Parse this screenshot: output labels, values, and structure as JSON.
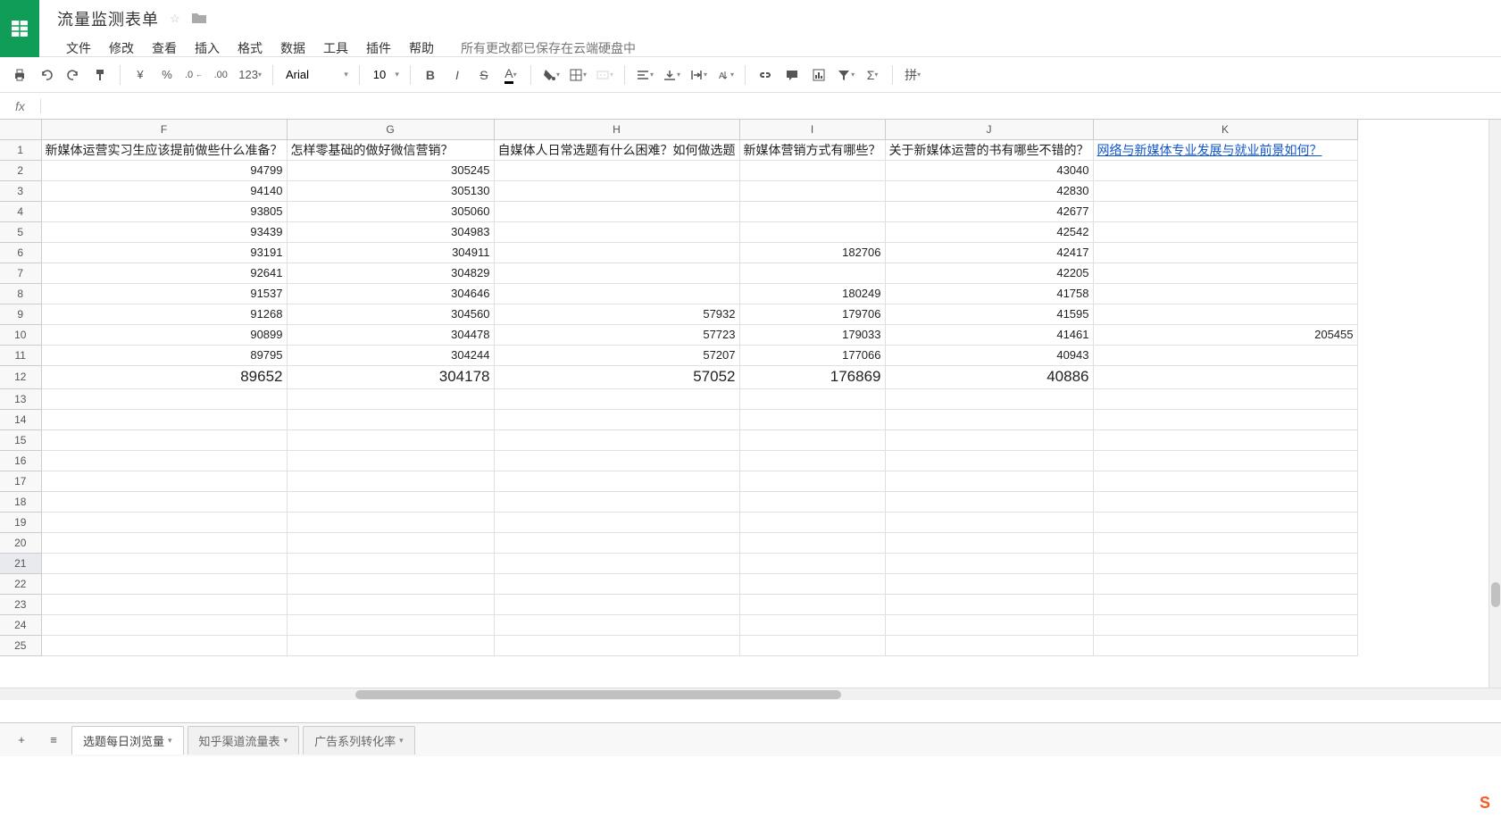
{
  "doc_title": "流量监测表单",
  "menu": [
    "文件",
    "修改",
    "查看",
    "插入",
    "格式",
    "数据",
    "工具",
    "插件",
    "帮助"
  ],
  "save_status": "所有更改都已保存在云端硬盘中",
  "toolbar": {
    "currency": "¥",
    "percent": "%",
    "dec_dec": ".0",
    "dec_inc": ".00",
    "more_formats": "123",
    "font_name": "Arial",
    "font_size": "10",
    "bold": "B",
    "italic": "I",
    "strike": "S",
    "text_color": "A",
    "pinyin": "拼"
  },
  "formula": {
    "fx": "fx",
    "value": ""
  },
  "columns": [
    "F",
    "G",
    "H",
    "I",
    "J",
    "K"
  ],
  "rows": [
    "1",
    "2",
    "3",
    "4",
    "5",
    "6",
    "7",
    "8",
    "9",
    "10",
    "11",
    "12",
    "13",
    "14",
    "15",
    "16",
    "17",
    "18",
    "19",
    "20",
    "21",
    "22",
    "23",
    "24",
    "25"
  ],
  "selected_row": "21",
  "headers_row1": {
    "F": "新媒体运营实习生应该提前做些什么准备？",
    "G": "怎样零基础的做好微信营销？",
    "H": "自媒体人日常选题有什么困难？如何做选题",
    "I": "新媒体营销方式有哪些？",
    "J": "关于新媒体运营的书有哪些不错的？",
    "K": "网络与新媒体专业发展与就业前景如何？"
  },
  "data": {
    "2": {
      "F": "94799",
      "G": "305245",
      "H": "",
      "I": "",
      "J": "43040",
      "K": ""
    },
    "3": {
      "F": "94140",
      "G": "305130",
      "H": "",
      "I": "",
      "J": "42830",
      "K": ""
    },
    "4": {
      "F": "93805",
      "G": "305060",
      "H": "",
      "I": "",
      "J": "42677",
      "K": ""
    },
    "5": {
      "F": "93439",
      "G": "304983",
      "H": "",
      "I": "",
      "J": "42542",
      "K": ""
    },
    "6": {
      "F": "93191",
      "G": "304911",
      "H": "",
      "I": "182706",
      "J": "42417",
      "K": ""
    },
    "7": {
      "F": "92641",
      "G": "304829",
      "H": "",
      "I": "",
      "J": "42205",
      "K": ""
    },
    "8": {
      "F": "91537",
      "G": "304646",
      "H": "",
      "I": "180249",
      "J": "41758",
      "K": ""
    },
    "9": {
      "F": "91268",
      "G": "304560",
      "H": "57932",
      "I": "179706",
      "J": "41595",
      "K": ""
    },
    "10": {
      "F": "90899",
      "G": "304478",
      "H": "57723",
      "I": "179033",
      "J": "41461",
      "K": "205455"
    },
    "11": {
      "F": "89795",
      "G": "304244",
      "H": "57207",
      "I": "177066",
      "J": "40943",
      "K": ""
    },
    "12": {
      "F": "89652",
      "G": "304178",
      "H": "57052",
      "I": "176869",
      "J": "40886",
      "K": ""
    }
  },
  "sheets": {
    "active": "选题每日浏览量",
    "others": [
      "知乎渠道流量表",
      "广告系列转化率"
    ]
  }
}
